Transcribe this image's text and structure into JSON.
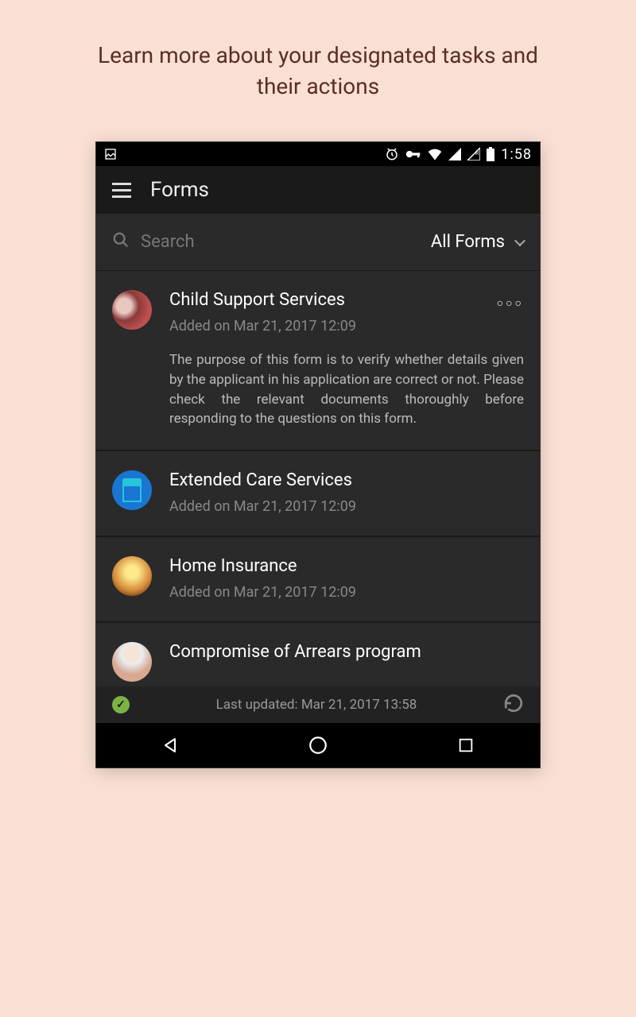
{
  "heading": "Learn more about your designated tasks and their actions",
  "status": {
    "time": "1:58"
  },
  "header": {
    "title": "Forms"
  },
  "search": {
    "placeholder": "Search",
    "filter_label": "All Forms"
  },
  "forms": [
    {
      "title": "Child Support Services",
      "date": "Added on Mar 21, 2017 12:09",
      "description": "The purpose of this form is to verify whether details given by the applicant in his application are correct or not. Please check the relevant documents thoroughly before responding to the questions on this form.",
      "expanded": true
    },
    {
      "title": "Extended Care Services",
      "date": "Added on Mar 21, 2017 12:09",
      "expanded": false
    },
    {
      "title": "Home Insurance",
      "date": "Added on Mar 21, 2017 12:09",
      "expanded": false
    },
    {
      "title": "Compromise of Arrears program",
      "date": "",
      "expanded": false
    }
  ],
  "footer": {
    "last_updated": "Last updated: Mar 21, 2017 13:58"
  }
}
